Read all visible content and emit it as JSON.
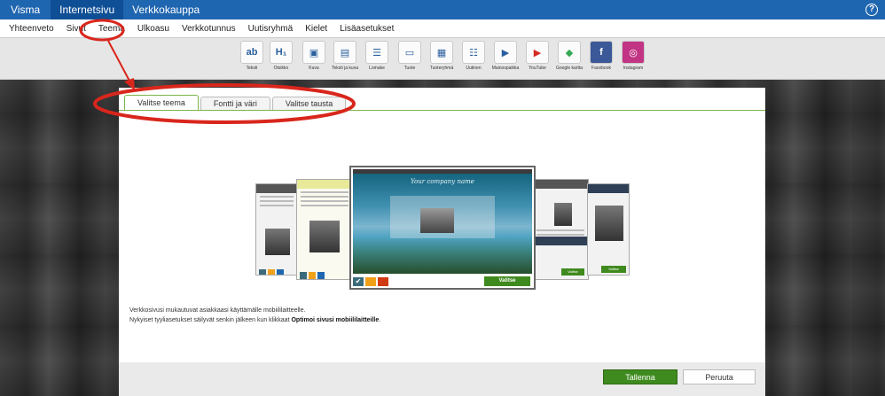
{
  "topbar": {
    "apps": [
      "Visma",
      "Internetsivu",
      "Verkkokauppa"
    ],
    "help": "?"
  },
  "navbar": {
    "items": [
      "Yhteenveto",
      "Sivut",
      "Teema",
      "Ulkoasu",
      "Verkkotunnus",
      "Uutisryhmä",
      "Kielet",
      "Lisäasetukset"
    ]
  },
  "toolbar": {
    "items": [
      {
        "label": "Teksti",
        "icon": "text-icon",
        "glyph": "ab"
      },
      {
        "label": "Otsikko",
        "icon": "heading-icon",
        "glyph": "H₁"
      },
      {
        "label": "Kuva",
        "icon": "image-icon",
        "glyph": "▣"
      },
      {
        "label": "Teksti ja kuva",
        "icon": "text-image-icon",
        "glyph": "▤"
      },
      {
        "label": "Lomake",
        "icon": "form-icon",
        "glyph": "☰"
      },
      {
        "label": "Tuote",
        "icon": "product-icon",
        "glyph": "▭"
      },
      {
        "label": "Tuoteryhmä",
        "icon": "product-group-icon",
        "glyph": "▦"
      },
      {
        "label": "Uutinen",
        "icon": "news-icon",
        "glyph": "☷"
      },
      {
        "label": "Mainospaikka",
        "icon": "ad-slot-icon",
        "glyph": "▶"
      },
      {
        "label": "YouTube",
        "icon": "youtube-icon",
        "glyph": "▶"
      },
      {
        "label": "Google kartta",
        "icon": "google-maps-icon",
        "glyph": "◆"
      },
      {
        "label": "Facebook",
        "icon": "facebook-icon",
        "glyph": "f"
      },
      {
        "label": "Instagram",
        "icon": "instagram-icon",
        "glyph": "◎"
      }
    ]
  },
  "tabs": [
    "Valitse teema",
    "Fontti ja väri",
    "Valitse tausta"
  ],
  "preview": {
    "site_name": "Your company name",
    "select_label": "Valitse",
    "side_select_label": "Valitse"
  },
  "info": {
    "line1": "Verkkosivusi mukautuvat asiakkaasi käyttämälle mobiililaitteelle.",
    "line2_prefix": "Nykyiset tyyliasetukset säilyvät senkin jälkeen kun klikkaat ",
    "line2_bold": "Optimoi sivusi mobiililaitteille",
    "line2_suffix": "."
  },
  "footer": {
    "save": "Tallenna",
    "cancel": "Peruuta"
  },
  "colors": {
    "topbar": "#1f66b0",
    "accent_green": "#3f8a1e",
    "annotation_red": "#d9261c",
    "swatch_check": "#3b6b7a",
    "swatch_orange": "#f0a11a",
    "swatch_red": "#d13b14"
  }
}
